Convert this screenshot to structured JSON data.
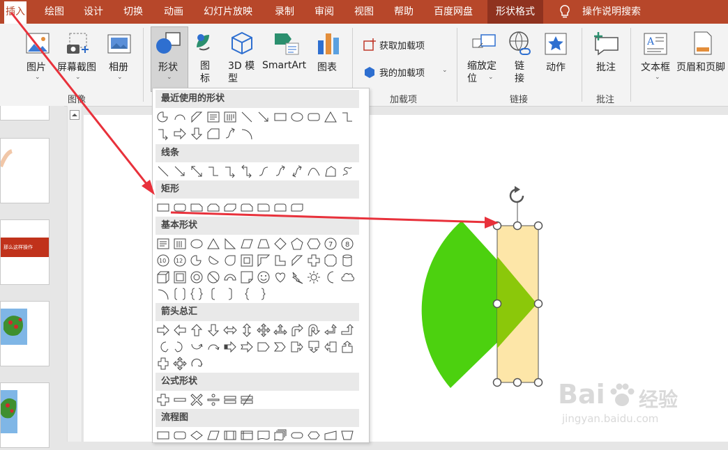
{
  "tabs": [
    "插入",
    "绘图",
    "设计",
    "切换",
    "动画",
    "幻灯片放映",
    "录制",
    "审阅",
    "视图",
    "帮助",
    "百度网盘",
    "形状格式"
  ],
  "active_tab": "插入",
  "tell_me": "操作说明搜索",
  "ribbon": {
    "images": {
      "picture": "图片",
      "screenshot": "屏幕截图",
      "album": "相册",
      "group": "图像"
    },
    "shapes": {
      "shapes": "形状",
      "icons": "图标",
      "model3d": "3D 模型",
      "smartart": "SmartArt",
      "chart": "图表"
    },
    "addins": {
      "get": "获取加载项",
      "mine": "我的加载项",
      "group": "加载项"
    },
    "links": {
      "zoom": "缩放定位",
      "link": "链接",
      "action": "动作",
      "group": "链接"
    },
    "comments": {
      "comment": "批注",
      "group": "批注"
    },
    "text": {
      "textbox": "文本框",
      "header": "页眉和页脚"
    }
  },
  "dropdown": {
    "sections": [
      "最近使用的形状",
      "线条",
      "矩形",
      "基本形状",
      "箭头总汇",
      "公式形状",
      "流程图"
    ]
  },
  "thumbnail_title": "那么这样操作",
  "colors": {
    "accent": "#b7472a",
    "sector": "#4cd10f",
    "rect_fill": "#fde39f",
    "overlap": "#8bc80a",
    "arrow": "#e8313b"
  },
  "watermark": {
    "brand": "Bai",
    "brand_tail": "经验",
    "url": "jingyan.baidu.com"
  }
}
